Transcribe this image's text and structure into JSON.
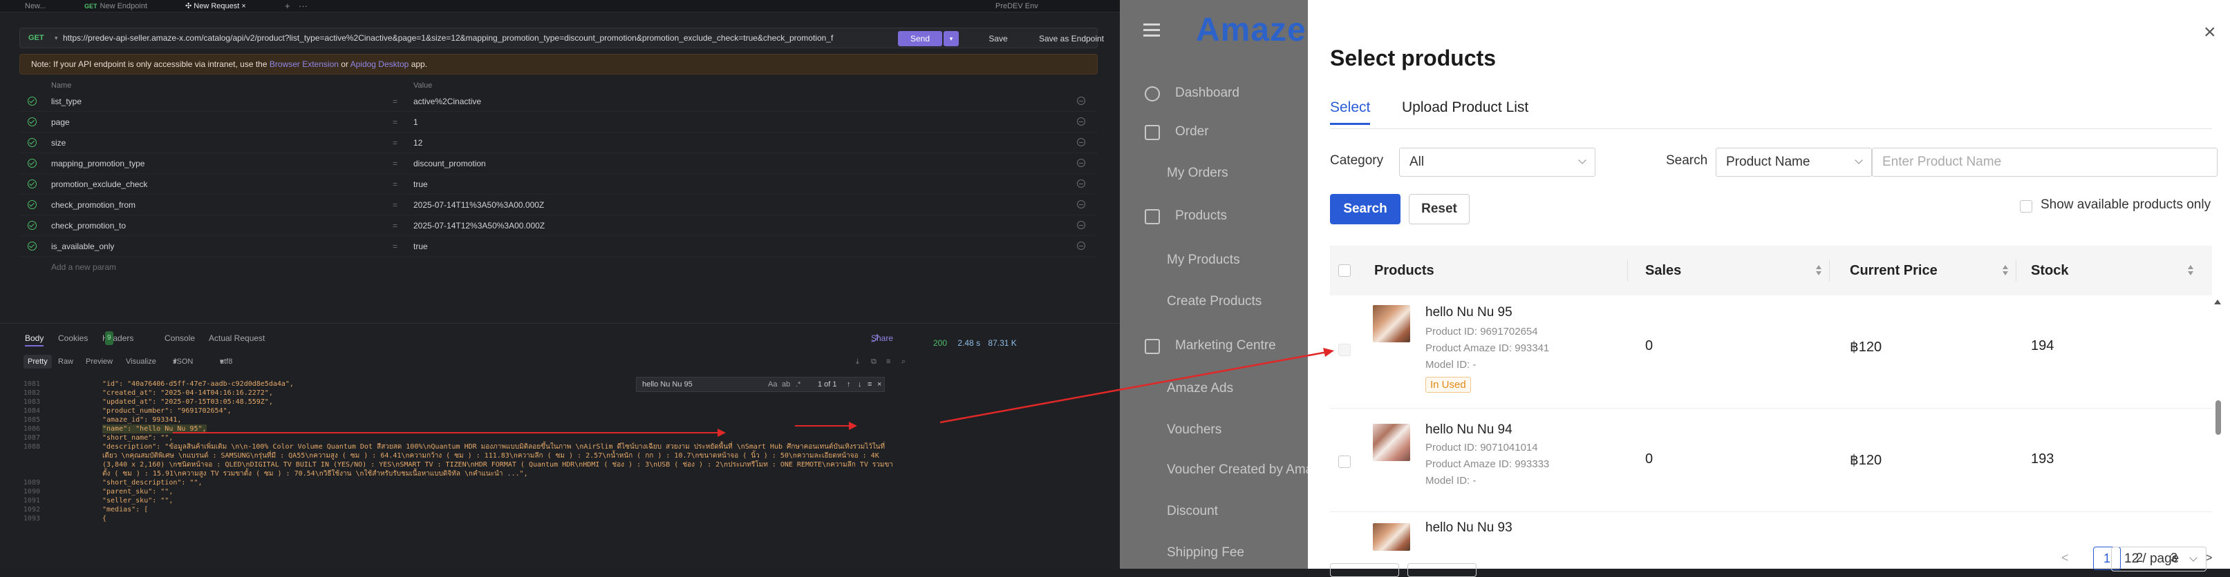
{
  "tabs": [
    {
      "method": "",
      "label": "New...",
      "active": false
    },
    {
      "method": "GET",
      "label": "New Endpoint",
      "active": false
    },
    {
      "method": "",
      "label": "✣ New Request",
      "active": true
    }
  ],
  "tab_close": "×",
  "tab_add": "+",
  "tab_more": "···",
  "env_label": "PreDEV Env",
  "request": {
    "method": "GET",
    "url": "https://predev-api-seller.amaze-x.com/catalog/api/v2/product?list_type=active%2Cinactive&page=1&size=12&mapping_promotion_type=discount_promotion&promotion_exclude_check=true&check_promotion_f",
    "send_label": "Send",
    "save_label": "Save",
    "save_endpoint_label": "Save as Endpoint"
  },
  "note": {
    "prefix": "Note: If your API endpoint is only accessible via intranet, use the",
    "link1": "Browser Extension",
    "middle": "or",
    "link2": "Apidog Desktop",
    "suffix": "app."
  },
  "params_header": {
    "name": "Name",
    "value": "Value"
  },
  "params": [
    {
      "name": "list_type",
      "value": "active%2Cinactive"
    },
    {
      "name": "page",
      "value": "1"
    },
    {
      "name": "size",
      "value": "12"
    },
    {
      "name": "mapping_promotion_type",
      "value": "discount_promotion"
    },
    {
      "name": "promotion_exclude_check",
      "value": "true"
    },
    {
      "name": "check_promotion_from",
      "value": "2025-07-14T11%3A50%3A00.000Z"
    },
    {
      "name": "check_promotion_to",
      "value": "2025-07-14T12%3A50%3A00.000Z"
    },
    {
      "name": "is_available_only",
      "value": "true"
    }
  ],
  "params_eq": "=",
  "add_param": "Add a new param",
  "response_tabs": {
    "body": "Body",
    "cookies": "Cookies",
    "headers": "Headers",
    "headers_count": "9",
    "console": "Console",
    "actual": "Actual Request",
    "share": "Share"
  },
  "status": {
    "code": "200",
    "time": "2.48 s",
    "size": "87.31 K"
  },
  "format_bar": {
    "pretty": "Pretty",
    "raw": "Raw",
    "preview": "Preview",
    "visualize": "Visualize",
    "format": "JSON",
    "encoding": "utf8"
  },
  "find": {
    "query": "hello Nu Nu 95",
    "count": "1 of 1",
    "opts": "Aa",
    "word": "ab",
    "regex": ".*"
  },
  "code_lines": [
    {
      "n": "1081",
      "t": "\"id\": \"40a76406-d5ff-47e7-aadb-c92d0d8e5da4a\","
    },
    {
      "n": "1082",
      "t": "\"created_at\": \"2025-04-14T04:16:16.2272\","
    },
    {
      "n": "1083",
      "t": "\"updated_at\": \"2025-07-15T03:05:48.559Z\","
    },
    {
      "n": "1084",
      "t": "\"product_number\": \"9691702654\","
    },
    {
      "n": "1085",
      "t": "\"amaze_id\": 993341,"
    },
    {
      "n": "1086",
      "t": "\"name\": \"hello Nu Nu 95\","
    },
    {
      "n": "1087",
      "t": "\"short_name\": \"\","
    },
    {
      "n": "1088",
      "t": "\"description\": \"ข้อมูลสินค้าเพิ่มเติม \\n\\n-100% Color Volume Quantum Dot สีสวยสด 100%\\nQuantum HDR มองภาพแบบมิติลอยขึ้นในภาพ \\nAirSlim ดีไซน์บางเฉียบ สวยงาม ประหยัดพื้นที่ \\nSmart Hub ศึกษาคอนเทนต์บันเทิงรวมไว้ในที่เดียว \\nคุณสมบัติพิเศษ \\nแบรนด์ : SAMSUNG\\nรุ่นที่มี : QA55\\nความสูง ( ซม ) : 64.41\\nความกว้าง ( ซม ) : 111.83\\nความลึก ( ซม ) : 2.57\\nน้ำหนัก ( กก ) : 10.7\\nขนาดหน้าจอ ( นิ้ว ) : 50\\nความละเอียดหน้าจอ : 4K (3,840 x 2,160) \\nชนิดหน้าจอ : QLED\\nDIGITAL TV BUILT IN (YES/NO) : YES\\nSMART TV : TIZEN\\nHDR FORMAT ( Quantum HDR\\nHDMI ( ช่อง ) : 3\\nUSB ( ช่อง ) : 2\\nประเภทรีโมท : ONE REMOTE\\nความลึก TV รวมขาตั้ง ( ซม ) : 15.91\\nความสูง TV รวมขาตั้ง ( ซม ) : 70.54\\nวิธีใช้งาน \\nใช้สำหรับรับชมเนื้อหาแบบดิจิทัล \\nคำแนะนำ ...\","
    },
    {
      "n": "1089",
      "t": "\"short_description\": \"\","
    },
    {
      "n": "1090",
      "t": "\"parent_sku\": \"\","
    },
    {
      "n": "1091",
      "t": "\"seller_sku\": \"\","
    },
    {
      "n": "1092",
      "t": "\"medias\": ["
    },
    {
      "n": "1093",
      "t": "{"
    }
  ],
  "seller_nav": {
    "brand": "Amaze",
    "items": [
      {
        "label": "Dashboard",
        "level": 0
      },
      {
        "label": "Order",
        "level": 0
      },
      {
        "label": "My Orders",
        "level": 1
      },
      {
        "label": "Products",
        "level": 0
      },
      {
        "label": "My Products",
        "level": 1
      },
      {
        "label": "Create Products",
        "level": 1
      },
      {
        "label": "Marketing Centre",
        "level": 0
      },
      {
        "label": "Amaze Ads",
        "level": 1
      },
      {
        "label": "Vouchers",
        "level": 1
      },
      {
        "label": "Voucher Created by Ama",
        "level": 1
      },
      {
        "label": "Discount",
        "level": 1
      },
      {
        "label": "Shipping Fee",
        "level": 1
      }
    ]
  },
  "modal": {
    "title": "Select products",
    "close": "×",
    "tab_select": "Select",
    "tab_upload": "Upload Product List",
    "category_label": "Category",
    "category_value": "All",
    "search_label": "Search",
    "search_field": "Product Name",
    "search_placeholder": "Enter Product Name",
    "search_button": "Search",
    "reset_button": "Reset",
    "available_only": "Show available products only",
    "columns": {
      "products": "Products",
      "sales": "Sales",
      "price": "Current Price",
      "stock": "Stock"
    },
    "rows": [
      {
        "name": "hello Nu Nu 95",
        "product_id": "Product ID: 9691702654",
        "amaze_id": "Product Amaze ID: 993341",
        "model_id": "Model ID: -",
        "badge": "In Used",
        "sales": "0",
        "price": "฿120",
        "stock": "194"
      },
      {
        "name": "hello Nu Nu 94",
        "product_id": "Product ID: 9071041014",
        "amaze_id": "Product Amaze ID: 993333",
        "model_id": "Model ID: -",
        "badge": "",
        "sales": "0",
        "price": "฿120",
        "stock": "193"
      },
      {
        "name": "hello Nu Nu 93",
        "product_id": "",
        "amaze_id": "",
        "model_id": "",
        "badge": "",
        "sales": "",
        "price": "",
        "stock": ""
      }
    ],
    "pager": {
      "prev": "<",
      "pages": [
        "1",
        "2",
        "3"
      ],
      "next": ">",
      "current": "1",
      "per_page": "12 / page"
    }
  },
  "colors": {
    "accent": "#2a5bd7",
    "send": "#7b6cd9",
    "get": "#4fbf6b",
    "arrow": "#e02828",
    "in_used": "#e08a17"
  }
}
